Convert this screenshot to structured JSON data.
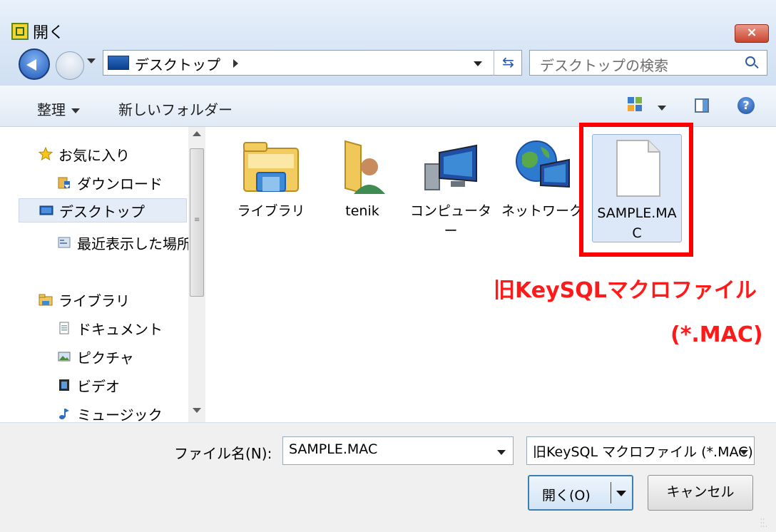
{
  "window": {
    "title": "開く",
    "close_label": "×"
  },
  "navbar": {
    "address": "デスクトップ",
    "search_placeholder": "デスクトップの検索",
    "refresh_glyph": "⇆"
  },
  "commandbar": {
    "organize": "整理",
    "new_folder": "新しいフォルダー",
    "help": "?"
  },
  "nav_pane": {
    "items": [
      {
        "label": "お気に入り",
        "icon": "star-icon"
      },
      {
        "label": "ダウンロード",
        "icon": "download-icon"
      },
      {
        "label": "デスクトップ",
        "icon": "desktop-icon"
      },
      {
        "label": "最近表示した場所",
        "icon": "recent-places-icon"
      },
      {
        "label": "ライブラリ",
        "icon": "library-icon"
      },
      {
        "label": "ドキュメント",
        "icon": "documents-icon"
      },
      {
        "label": "ピクチャ",
        "icon": "pictures-icon"
      },
      {
        "label": "ビデオ",
        "icon": "video-icon"
      },
      {
        "label": "ミュージック",
        "icon": "music-icon"
      }
    ],
    "scroll_grip": "≡"
  },
  "files": [
    {
      "name": "ライブラリ",
      "icon": "library-folder-icon"
    },
    {
      "name": "tenik",
      "icon": "user-folder-icon"
    },
    {
      "name": "コンピューター",
      "icon": "computer-icon"
    },
    {
      "name": "ネットワーク",
      "icon": "network-icon"
    },
    {
      "name": "SAMPLE.MAC",
      "icon": "file-icon"
    }
  ],
  "annotation": {
    "line1": "旧KeySQLマクロファイル",
    "line2": "(*.MAC)",
    "color": "#ff0000"
  },
  "bottom": {
    "filename_label": "ファイル名(N):",
    "filename_value": "SAMPLE.MAC",
    "filetype_value": "旧KeySQL マクロファイル (*.MAC)",
    "open_button": "開く(O)",
    "cancel_button": "キャンセル"
  },
  "colors": {
    "selection": "#dce8f7",
    "accent": "#2a5aa8"
  }
}
